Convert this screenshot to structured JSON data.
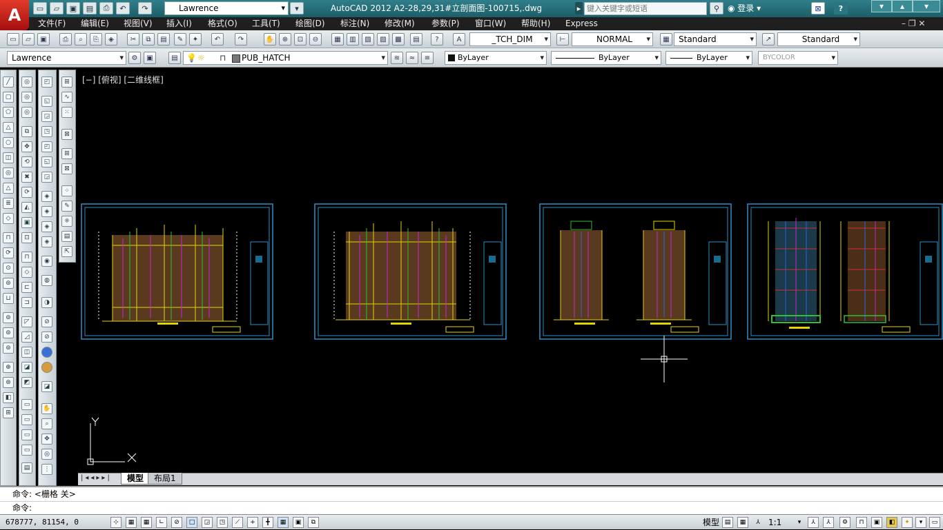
{
  "titlebar": {
    "app_logo": "A",
    "workspace": "Lawrence",
    "title": "AutoCAD 2012    A2-28,29,31#立剖面图-100715,.dwg",
    "search_placeholder": "键入关键字或短语",
    "login": "登录",
    "help": "?",
    "window_buttons": [
      "▾",
      "▴",
      "▾"
    ]
  },
  "menubar": {
    "items": [
      "文件(F)",
      "编辑(E)",
      "视图(V)",
      "插入(I)",
      "格式(O)",
      "工具(T)",
      "绘图(D)",
      "标注(N)",
      "修改(M)",
      "参数(P)",
      "窗口(W)",
      "帮助(H)",
      "Express"
    ],
    "mdi_buttons": "– ❐ ✕"
  },
  "toolbar1": {
    "dim_style": "_TCH_DIM",
    "text_style": "NORMAL",
    "table_style": "Standard",
    "multileader_style": "Standard"
  },
  "toolbar2": {
    "workspace": "Lawrence",
    "layer": "PUB_HATCH",
    "color": "ByLayer",
    "linetype": "ByLayer",
    "lineweight": "ByLayer",
    "plot_style": "BYCOLOR"
  },
  "viewport": {
    "label": "[−] [俯视] [二维线框]"
  },
  "tabs": {
    "model": "模型",
    "layout1": "布局1"
  },
  "command": {
    "history": "命令:  <栅格 关>",
    "prompt": "命令:"
  },
  "status": {
    "coords": "678777, 81154, 0",
    "model": "模型",
    "scale": "1:1"
  },
  "ucs": {
    "x_label": "X",
    "y_label": "Y"
  },
  "colors": {
    "canvas": "#000000",
    "sheet_border": "#2b90c8",
    "title_bar": "#2a7580",
    "menu_bg": "#1f1f1f"
  }
}
